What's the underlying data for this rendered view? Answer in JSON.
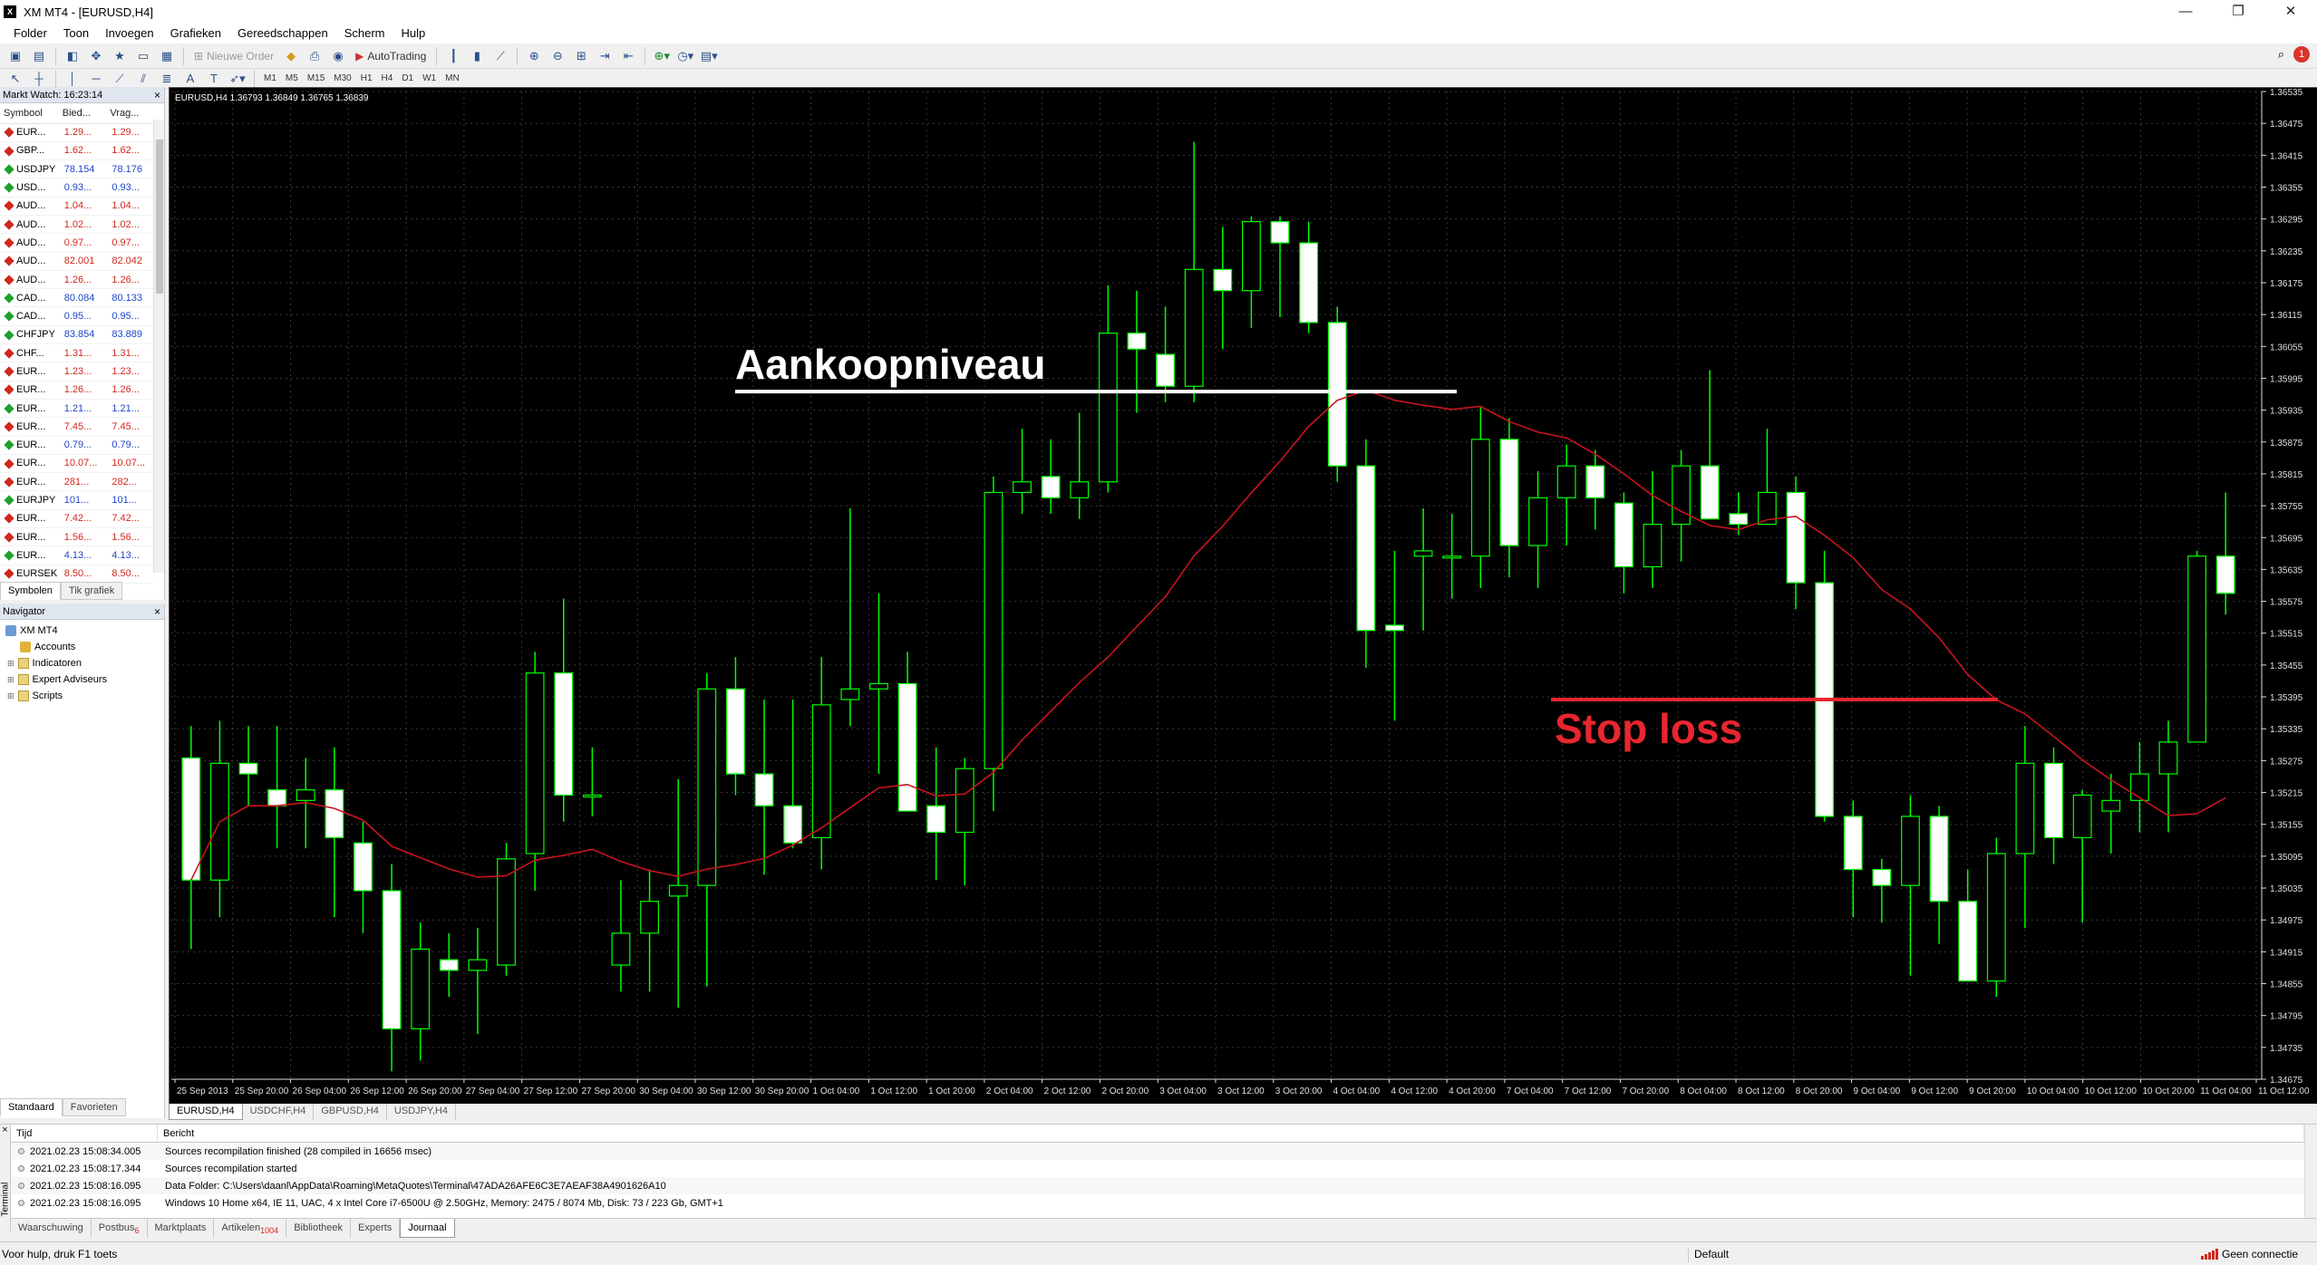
{
  "window": {
    "title": "XM MT4 - [EURUSD,H4]",
    "controls": [
      "—",
      "❐",
      "✕"
    ]
  },
  "menu": [
    "Folder",
    "Toon",
    "Invoegen",
    "Grafieken",
    "Gereedschappen",
    "Scherm",
    "Hulp"
  ],
  "toolbar": {
    "new_order": "Nieuwe Order",
    "autotrading": "AutoTrading",
    "timeframes": [
      "M1",
      "M5",
      "M15",
      "M30",
      "H1",
      "H4",
      "D1",
      "W1",
      "MN"
    ],
    "notification_count": "1"
  },
  "market_watch": {
    "header": "Markt Watch: 16:23:14",
    "close": "×",
    "columns": [
      "Symbool",
      "Bied...",
      "Vrag..."
    ],
    "rows": [
      {
        "symbol": "EUR...",
        "bid": "1.29...",
        "ask": "1.29...",
        "dir": "down"
      },
      {
        "symbol": "GBP...",
        "bid": "1.62...",
        "ask": "1.62...",
        "dir": "down"
      },
      {
        "symbol": "USDJPY",
        "bid": "78.154",
        "ask": "78.176",
        "dir": "up"
      },
      {
        "symbol": "USD...",
        "bid": "0.93...",
        "ask": "0.93...",
        "dir": "up"
      },
      {
        "symbol": "AUD...",
        "bid": "1.04...",
        "ask": "1.04...",
        "dir": "down"
      },
      {
        "symbol": "AUD...",
        "bid": "1.02...",
        "ask": "1.02...",
        "dir": "down"
      },
      {
        "symbol": "AUD...",
        "bid": "0.97...",
        "ask": "0.97...",
        "dir": "down"
      },
      {
        "symbol": "AUD...",
        "bid": "82.001",
        "ask": "82.042",
        "dir": "down"
      },
      {
        "symbol": "AUD...",
        "bid": "1.26...",
        "ask": "1.26...",
        "dir": "down"
      },
      {
        "symbol": "CAD...",
        "bid": "80.084",
        "ask": "80.133",
        "dir": "up"
      },
      {
        "symbol": "CAD...",
        "bid": "0.95...",
        "ask": "0.95...",
        "dir": "up"
      },
      {
        "symbol": "CHFJPY",
        "bid": "83.854",
        "ask": "83.889",
        "dir": "up"
      },
      {
        "symbol": "CHF...",
        "bid": "1.31...",
        "ask": "1.31...",
        "dir": "down"
      },
      {
        "symbol": "EUR...",
        "bid": "1.23...",
        "ask": "1.23...",
        "dir": "down"
      },
      {
        "symbol": "EUR...",
        "bid": "1.26...",
        "ask": "1.26...",
        "dir": "down"
      },
      {
        "symbol": "EUR...",
        "bid": "1.21...",
        "ask": "1.21...",
        "dir": "up"
      },
      {
        "symbol": "EUR...",
        "bid": "7.45...",
        "ask": "7.45...",
        "dir": "down"
      },
      {
        "symbol": "EUR...",
        "bid": "0.79...",
        "ask": "0.79...",
        "dir": "up"
      },
      {
        "symbol": "EUR...",
        "bid": "10.07...",
        "ask": "10.07...",
        "dir": "down"
      },
      {
        "symbol": "EUR...",
        "bid": "281...",
        "ask": "282...",
        "dir": "down"
      },
      {
        "symbol": "EURJPY",
        "bid": "101...",
        "ask": "101...",
        "dir": "up"
      },
      {
        "symbol": "EUR...",
        "bid": "7.42...",
        "ask": "7.42...",
        "dir": "down"
      },
      {
        "symbol": "EUR...",
        "bid": "1.56...",
        "ask": "1.56...",
        "dir": "down"
      },
      {
        "symbol": "EUR...",
        "bid": "4.13...",
        "ask": "4.13...",
        "dir": "up"
      },
      {
        "symbol": "EURSEK",
        "bid": "8.50...",
        "ask": "8.50...",
        "dir": "down"
      }
    ],
    "tabs": [
      "Symbolen",
      "Tik grafiek"
    ]
  },
  "navigator": {
    "header": "Navigator",
    "close": "×",
    "root": "XM MT4",
    "items": [
      "Accounts",
      "Indicatoren",
      "Expert Adviseurs",
      "Scripts"
    ],
    "tabs": [
      "Standaard",
      "Favorieten"
    ]
  },
  "chart": {
    "info": "EURUSD,H4  1.36793 1.36849 1.36765 1.36839",
    "annotation_buy": "Aankoopniveau",
    "annotation_stop": "Stop loss",
    "colors": {
      "background": "#000000",
      "grid": "#3a3a3a",
      "bull": "#000000",
      "bear": "#ffffff",
      "wick": "#00ff00",
      "ma": "#c8141e",
      "buy_line": "#ffffff",
      "stop_line": "#e8262e"
    },
    "tabs": [
      "EURUSD,H4",
      "USDCHF,H4",
      "GBPUSD,H4",
      "USDJPY,H4"
    ]
  },
  "chart_data": {
    "type": "candlestick",
    "symbol": "EURUSD",
    "timeframe": "H4",
    "y_ticks": [
      "1.36535",
      "1.36475",
      "1.36415",
      "1.36355",
      "1.36295",
      "1.36235",
      "1.36175",
      "1.36115",
      "1.36055",
      "1.35995",
      "1.35935",
      "1.35875",
      "1.35815",
      "1.35755",
      "1.35695",
      "1.35635",
      "1.35575",
      "1.35515",
      "1.35455",
      "1.35395",
      "1.35335",
      "1.35275",
      "1.35215",
      "1.35155",
      "1.35095",
      "1.35035",
      "1.34975",
      "1.34915",
      "1.34855",
      "1.34795",
      "1.34735",
      "1.34675"
    ],
    "x_ticks": [
      "25 Sep 2013",
      "25 Sep 20:00",
      "26 Sep 04:00",
      "26 Sep 12:00",
      "26 Sep 20:00",
      "27 Sep 04:00",
      "27 Sep 12:00",
      "27 Sep 20:00",
      "30 Sep 04:00",
      "30 Sep 12:00",
      "30 Sep 20:00",
      "1 Oct 04:00",
      "1 Oct 12:00",
      "1 Oct 20:00",
      "2 Oct 04:00",
      "2 Oct 12:00",
      "2 Oct 20:00",
      "3 Oct 04:00",
      "3 Oct 12:00",
      "3 Oct 20:00",
      "4 Oct 04:00",
      "4 Oct 12:00",
      "4 Oct 20:00",
      "7 Oct 04:00",
      "7 Oct 12:00",
      "7 Oct 20:00",
      "8 Oct 04:00",
      "8 Oct 12:00",
      "8 Oct 20:00",
      "9 Oct 04:00",
      "9 Oct 12:00",
      "9 Oct 20:00",
      "10 Oct 04:00",
      "10 Oct 12:00",
      "10 Oct 20:00",
      "11 Oct 04:00",
      "11 Oct 12:00"
    ],
    "ylim": [
      1.34675,
      1.36535
    ],
    "candles": [
      {
        "o": 1.3528,
        "h": 1.3534,
        "l": 1.3492,
        "c": 1.3505
      },
      {
        "o": 1.3505,
        "h": 1.3535,
        "l": 1.3498,
        "c": 1.3527
      },
      {
        "o": 1.3527,
        "h": 1.3534,
        "l": 1.3519,
        "c": 1.3525
      },
      {
        "o": 1.3522,
        "h": 1.3534,
        "l": 1.3511,
        "c": 1.3519
      },
      {
        "o": 1.352,
        "h": 1.3528,
        "l": 1.3511,
        "c": 1.3522
      },
      {
        "o": 1.3522,
        "h": 1.353,
        "l": 1.3498,
        "c": 1.3513
      },
      {
        "o": 1.3512,
        "h": 1.3516,
        "l": 1.3495,
        "c": 1.3503
      },
      {
        "o": 1.3503,
        "h": 1.3508,
        "l": 1.3469,
        "c": 1.3477
      },
      {
        "o": 1.3477,
        "h": 1.3497,
        "l": 1.3471,
        "c": 1.3492
      },
      {
        "o": 1.349,
        "h": 1.3495,
        "l": 1.3483,
        "c": 1.3488
      },
      {
        "o": 1.3488,
        "h": 1.3496,
        "l": 1.3476,
        "c": 1.349
      },
      {
        "o": 1.3489,
        "h": 1.3512,
        "l": 1.3487,
        "c": 1.3509
      },
      {
        "o": 1.351,
        "h": 1.3548,
        "l": 1.3503,
        "c": 1.3544
      },
      {
        "o": 1.3544,
        "h": 1.3558,
        "l": 1.3516,
        "c": 1.3521
      },
      {
        "o": 1.3521,
        "h": 1.353,
        "l": 1.3517,
        "c": 1.3521
      },
      {
        "o": 1.3489,
        "h": 1.3505,
        "l": 1.3484,
        "c": 1.3495
      },
      {
        "o": 1.3495,
        "h": 1.3507,
        "l": 1.3484,
        "c": 1.3501
      },
      {
        "o": 1.3502,
        "h": 1.3524,
        "l": 1.3481,
        "c": 1.3504
      },
      {
        "o": 1.3504,
        "h": 1.3544,
        "l": 1.3485,
        "c": 1.3541
      },
      {
        "o": 1.3541,
        "h": 1.3547,
        "l": 1.3521,
        "c": 1.3525
      },
      {
        "o": 1.3525,
        "h": 1.3539,
        "l": 1.3506,
        "c": 1.3519
      },
      {
        "o": 1.3519,
        "h": 1.3539,
        "l": 1.3511,
        "c": 1.3512
      },
      {
        "o": 1.3513,
        "h": 1.3547,
        "l": 1.3507,
        "c": 1.3538
      },
      {
        "o": 1.3539,
        "h": 1.3575,
        "l": 1.3534,
        "c": 1.3541
      },
      {
        "o": 1.3541,
        "h": 1.3559,
        "l": 1.3525,
        "c": 1.3542
      },
      {
        "o": 1.3542,
        "h": 1.3548,
        "l": 1.3518,
        "c": 1.3518
      },
      {
        "o": 1.3519,
        "h": 1.353,
        "l": 1.3505,
        "c": 1.3514
      },
      {
        "o": 1.3514,
        "h": 1.3528,
        "l": 1.3504,
        "c": 1.3526
      },
      {
        "o": 1.3526,
        "h": 1.3581,
        "l": 1.3518,
        "c": 1.3578
      },
      {
        "o": 1.3578,
        "h": 1.359,
        "l": 1.3574,
        "c": 1.358
      },
      {
        "o": 1.3581,
        "h": 1.3588,
        "l": 1.3574,
        "c": 1.3577
      },
      {
        "o": 1.3577,
        "h": 1.3593,
        "l": 1.3573,
        "c": 1.358
      },
      {
        "o": 1.358,
        "h": 1.3617,
        "l": 1.3578,
        "c": 1.3608
      },
      {
        "o": 1.3608,
        "h": 1.3616,
        "l": 1.3593,
        "c": 1.3605
      },
      {
        "o": 1.3604,
        "h": 1.3613,
        "l": 1.3595,
        "c": 1.3598
      },
      {
        "o": 1.3598,
        "h": 1.3644,
        "l": 1.3595,
        "c": 1.362
      },
      {
        "o": 1.362,
        "h": 1.3628,
        "l": 1.3605,
        "c": 1.3616
      },
      {
        "o": 1.3616,
        "h": 1.363,
        "l": 1.3609,
        "c": 1.3629
      },
      {
        "o": 1.3629,
        "h": 1.363,
        "l": 1.3611,
        "c": 1.3625
      },
      {
        "o": 1.3625,
        "h": 1.3629,
        "l": 1.3608,
        "c": 1.361
      },
      {
        "o": 1.361,
        "h": 1.3613,
        "l": 1.358,
        "c": 1.3583
      },
      {
        "o": 1.3583,
        "h": 1.3588,
        "l": 1.3545,
        "c": 1.3552
      },
      {
        "o": 1.3553,
        "h": 1.3567,
        "l": 1.3535,
        "c": 1.3552
      },
      {
        "o": 1.3566,
        "h": 1.3575,
        "l": 1.3552,
        "c": 1.3567
      },
      {
        "o": 1.3566,
        "h": 1.3574,
        "l": 1.3558,
        "c": 1.3566
      },
      {
        "o": 1.3566,
        "h": 1.3594,
        "l": 1.356,
        "c": 1.3588
      },
      {
        "o": 1.3588,
        "h": 1.3592,
        "l": 1.3562,
        "c": 1.3568
      },
      {
        "o": 1.3568,
        "h": 1.3582,
        "l": 1.356,
        "c": 1.3577
      },
      {
        "o": 1.3577,
        "h": 1.3587,
        "l": 1.3568,
        "c": 1.3583
      },
      {
        "o": 1.3583,
        "h": 1.3586,
        "l": 1.3571,
        "c": 1.3577
      },
      {
        "o": 1.3576,
        "h": 1.3578,
        "l": 1.3559,
        "c": 1.3564
      },
      {
        "o": 1.3564,
        "h": 1.3582,
        "l": 1.356,
        "c": 1.3572
      },
      {
        "o": 1.3572,
        "h": 1.3586,
        "l": 1.3565,
        "c": 1.3583
      },
      {
        "o": 1.3583,
        "h": 1.3601,
        "l": 1.3573,
        "c": 1.3573
      },
      {
        "o": 1.3574,
        "h": 1.3578,
        "l": 1.357,
        "c": 1.3572
      },
      {
        "o": 1.3572,
        "h": 1.359,
        "l": 1.3572,
        "c": 1.3578
      },
      {
        "o": 1.3578,
        "h": 1.3581,
        "l": 1.3556,
        "c": 1.3561
      },
      {
        "o": 1.3561,
        "h": 1.3567,
        "l": 1.3516,
        "c": 1.3517
      },
      {
        "o": 1.3517,
        "h": 1.352,
        "l": 1.3498,
        "c": 1.3507
      },
      {
        "o": 1.3507,
        "h": 1.3509,
        "l": 1.3497,
        "c": 1.3504
      },
      {
        "o": 1.3504,
        "h": 1.3521,
        "l": 1.3487,
        "c": 1.3517
      },
      {
        "o": 1.3517,
        "h": 1.3519,
        "l": 1.3493,
        "c": 1.3501
      },
      {
        "o": 1.3501,
        "h": 1.3507,
        "l": 1.3491,
        "c": 1.3486
      },
      {
        "o": 1.3486,
        "h": 1.3513,
        "l": 1.3483,
        "c": 1.351
      },
      {
        "o": 1.351,
        "h": 1.3534,
        "l": 1.3496,
        "c": 1.3527
      },
      {
        "o": 1.3527,
        "h": 1.353,
        "l": 1.3508,
        "c": 1.3513
      },
      {
        "o": 1.3513,
        "h": 1.3522,
        "l": 1.3497,
        "c": 1.3521
      },
      {
        "o": 1.3518,
        "h": 1.3525,
        "l": 1.351,
        "c": 1.352
      },
      {
        "o": 1.352,
        "h": 1.3531,
        "l": 1.3514,
        "c": 1.3525
      },
      {
        "o": 1.3525,
        "h": 1.3535,
        "l": 1.3514,
        "c": 1.3531
      },
      {
        "o": 1.3531,
        "h": 1.3567,
        "l": 1.3531,
        "c": 1.3566
      },
      {
        "o": 1.3566,
        "h": 1.3578,
        "l": 1.3555,
        "c": 1.3559
      }
    ],
    "ma_period_label": "",
    "annotations": [
      {
        "label": "Aankoopniveau",
        "price": 1.3597
      },
      {
        "label": "Stop loss",
        "price": 1.3539
      }
    ]
  },
  "terminal": {
    "side_label": "Terminal",
    "close": "×",
    "columns": [
      "Tijd",
      "Bericht"
    ],
    "rows": [
      {
        "time": "2021.02.23 15:08:34.005",
        "msg": "Sources recompilation finished (28 compiled in 16656 msec)"
      },
      {
        "time": "2021.02.23 15:08:17.344",
        "msg": "Sources recompilation started"
      },
      {
        "time": "2021.02.23 15:08:16.095",
        "msg": "Data Folder: C:\\Users\\daanl\\AppData\\Roaming\\MetaQuotes\\Terminal\\47ADA26AFE6C3E7AEAF38A4901626A10"
      },
      {
        "time": "2021.02.23 15:08:16.095",
        "msg": "Windows 10 Home x64, IE 11, UAC, 4 x Intel Core i7-6500U  @ 2.50GHz, Memory: 2475 / 8074 Mb, Disk: 73 / 223 Gb, GMT+1"
      }
    ],
    "tabs": [
      {
        "label": "Waarschuwing",
        "badge": ""
      },
      {
        "label": "Postbus",
        "badge": "6"
      },
      {
        "label": "Marktplaats",
        "badge": ""
      },
      {
        "label": "Artikelen",
        "badge": "1004"
      },
      {
        "label": "Bibliotheek",
        "badge": ""
      },
      {
        "label": "Experts",
        "badge": ""
      },
      {
        "label": "Journaal",
        "badge": ""
      }
    ]
  },
  "statusbar": {
    "help": "Voor hulp, druk F1 toets",
    "profile": "Default",
    "connection": "Geen connectie"
  }
}
